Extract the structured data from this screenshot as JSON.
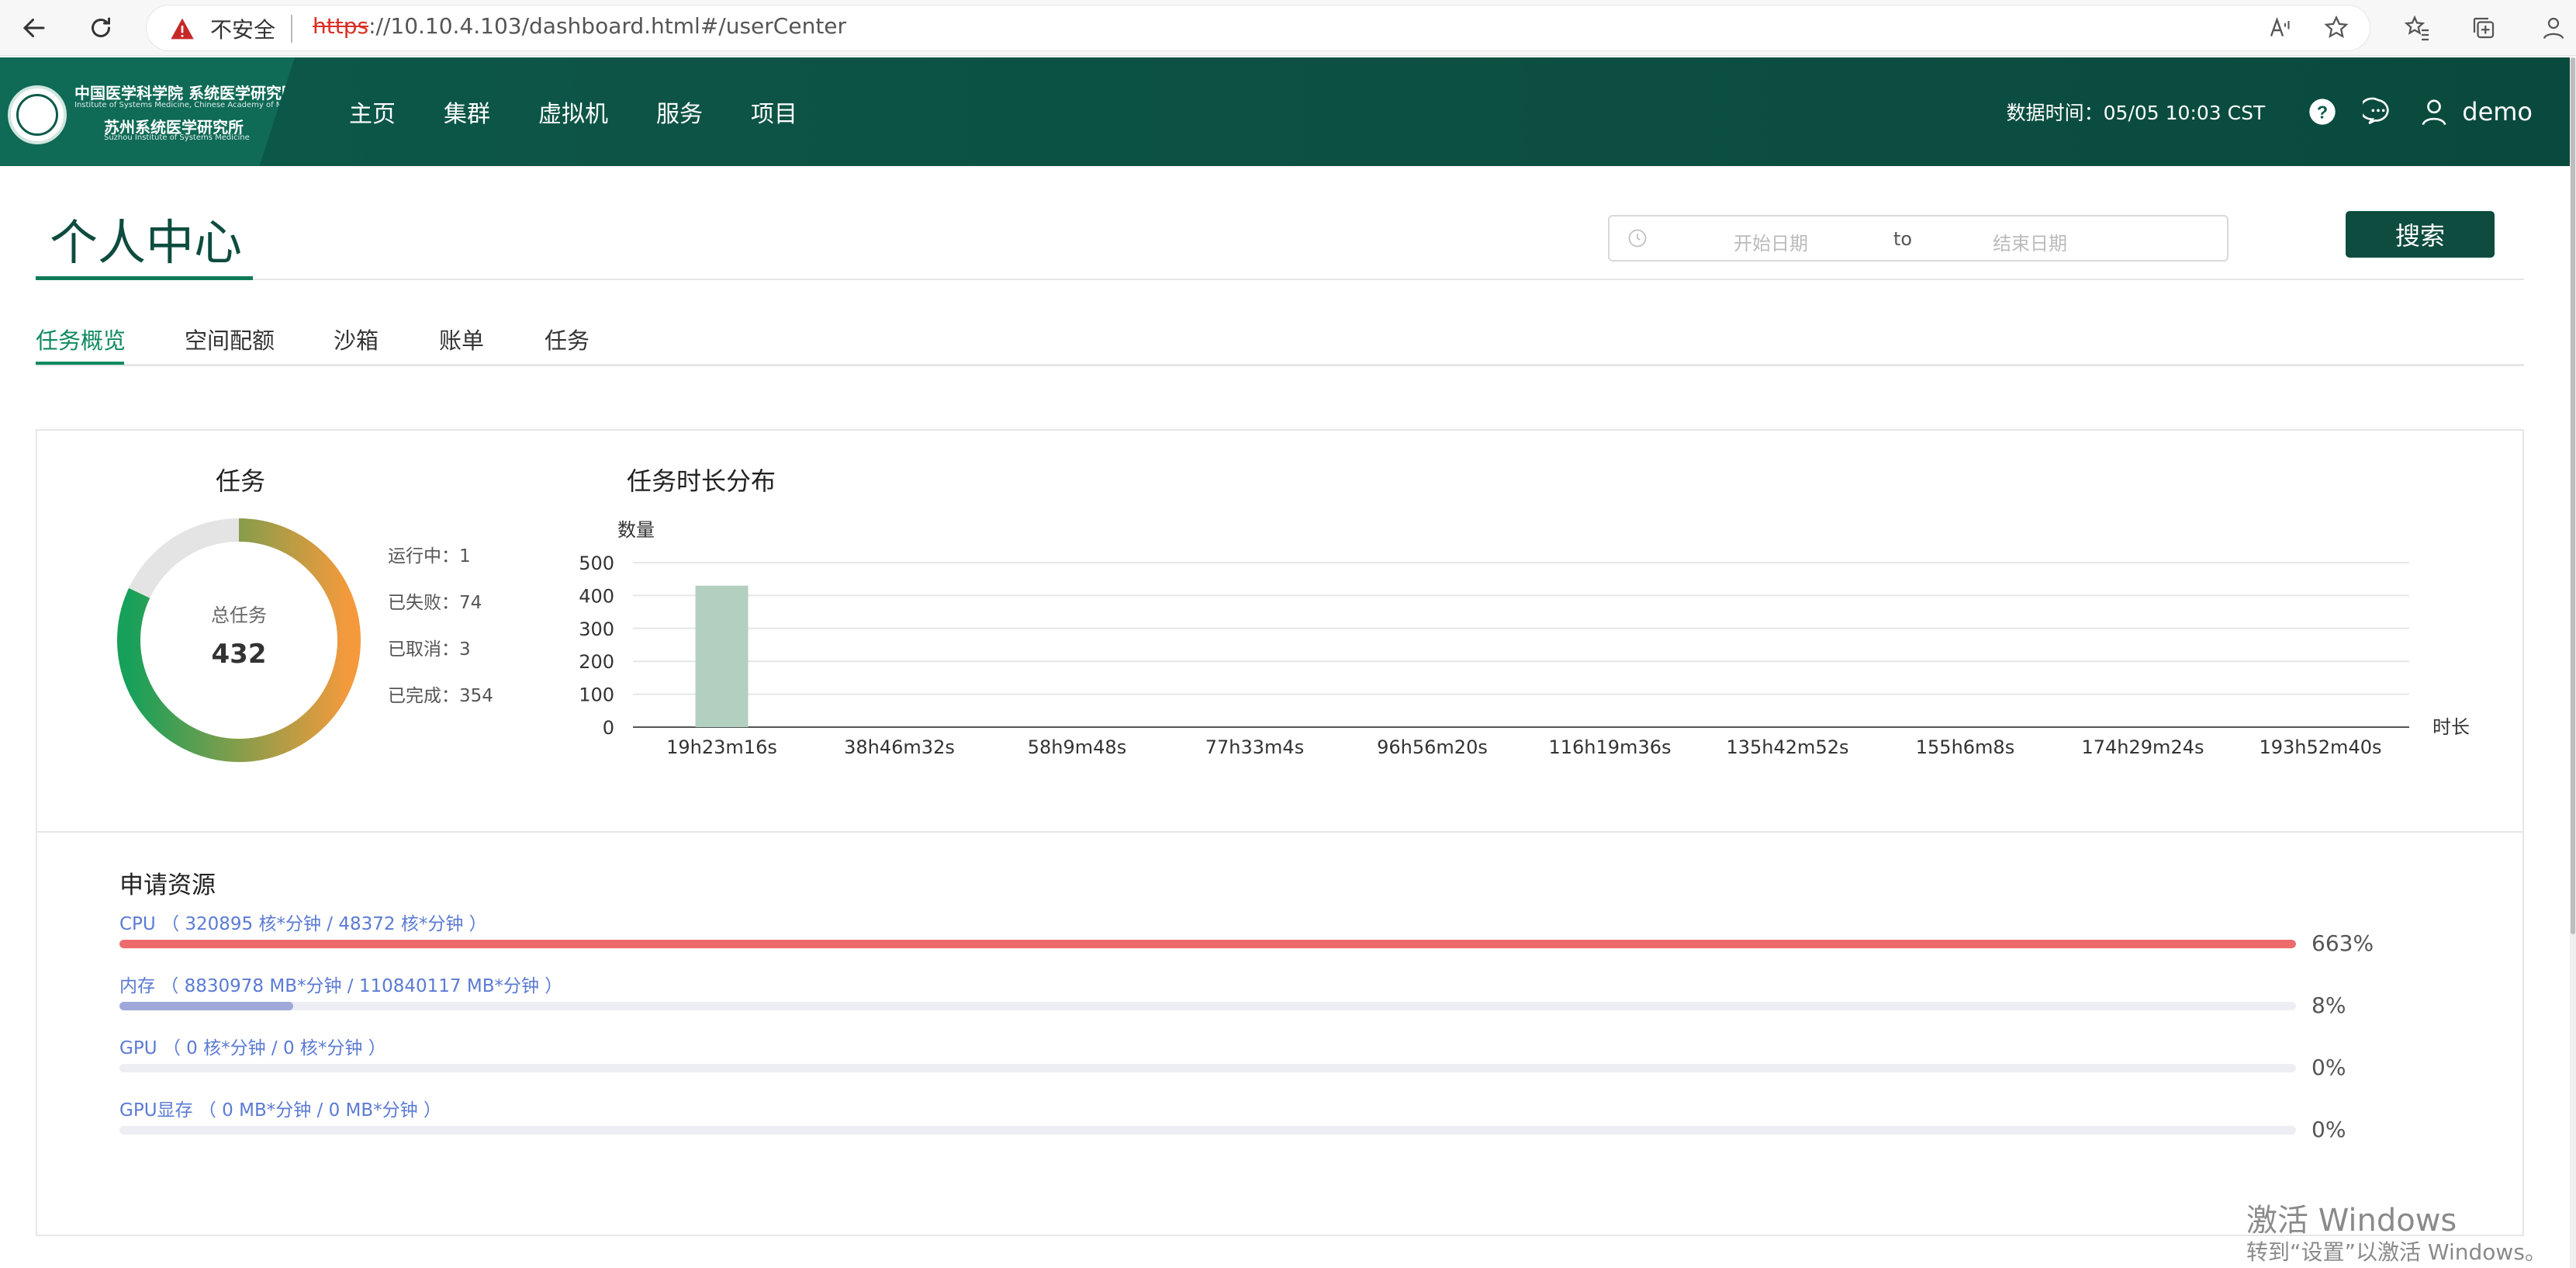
{
  "browser": {
    "insecure_label": "不安全",
    "url_scheme": "https",
    "url_rest": "://10.10.4.103/dashboard.html#/userCenter"
  },
  "header": {
    "logo_line1": "中国医学科学院 系统医学研究院",
    "logo_line2": "Institute of Systems Medicine, Chinese Academy of Medical Sciences",
    "logo_line3": "苏州系统医学研究所",
    "logo_line4": "Suzhou Institute of Systems Medicine",
    "nav": [
      "主页",
      "集群",
      "虚拟机",
      "服务",
      "项目"
    ],
    "data_time": "数据时间：05/05 10:03 CST",
    "user": "demo"
  },
  "page": {
    "title": "个人中心",
    "date_start_placeholder": "开始日期",
    "date_sep": "to",
    "date_end_placeholder": "结束日期",
    "search_label": "搜索"
  },
  "tabs": [
    {
      "label": "任务概览",
      "active": true
    },
    {
      "label": "空间配额",
      "active": false
    },
    {
      "label": "沙箱",
      "active": false
    },
    {
      "label": "账单",
      "active": false
    },
    {
      "label": "任务",
      "active": false
    }
  ],
  "tasks": {
    "title": "任务",
    "total_label": "总任务",
    "total": "432",
    "legend": [
      {
        "label": "运行中：1",
        "value": 1
      },
      {
        "label": "已失败：74",
        "value": 74
      },
      {
        "label": "已取消：3",
        "value": 3
      },
      {
        "label": "已完成：354",
        "value": 354
      }
    ],
    "donut_progress": 0.82,
    "colors": {
      "start": "#16a05a",
      "end": "#f59a3c",
      "track": "#e4e4e4"
    }
  },
  "chart_data": {
    "type": "bar",
    "title": "任务时长分布",
    "ylabel": "数量",
    "xlabel": "时长",
    "categories": [
      "19h23m16s",
      "38h46m32s",
      "58h9m48s",
      "77h33m4s",
      "96h56m20s",
      "116h19m36s",
      "135h42m52s",
      "155h6m8s",
      "174h29m24s",
      "193h52m40s"
    ],
    "values": [
      430,
      0,
      0,
      0,
      0,
      0,
      0,
      0,
      0,
      0
    ],
    "yticks": [
      0,
      100,
      200,
      300,
      400,
      500
    ],
    "ylim": [
      0,
      500
    ],
    "bar_color": "#b2cfc0",
    "grid": true
  },
  "resources": {
    "title": "申请资源",
    "items": [
      {
        "label": "CPU （ 320895 核*分钟 / 48372 核*分钟 ）",
        "percent_label": "663%",
        "fill": 1.0,
        "color": "#ee6b6b"
      },
      {
        "label": "内存 （ 8830978 MB*分钟 / 110840117 MB*分钟 ）",
        "percent_label": "8%",
        "fill": 0.08,
        "color": "#9fa8d9"
      },
      {
        "label": "GPU （ 0 核*分钟 / 0 核*分钟 ）",
        "percent_label": "0%",
        "fill": 0.0,
        "color": "#9fa8d9"
      },
      {
        "label": "GPU显存 （ 0 MB*分钟 / 0 MB*分钟 ）",
        "percent_label": "0%",
        "fill": 0.0,
        "color": "#9fa8d9"
      }
    ]
  },
  "watermark": {
    "line1": "激活 Windows",
    "line2": "转到“设置”以激活 Windows。"
  }
}
